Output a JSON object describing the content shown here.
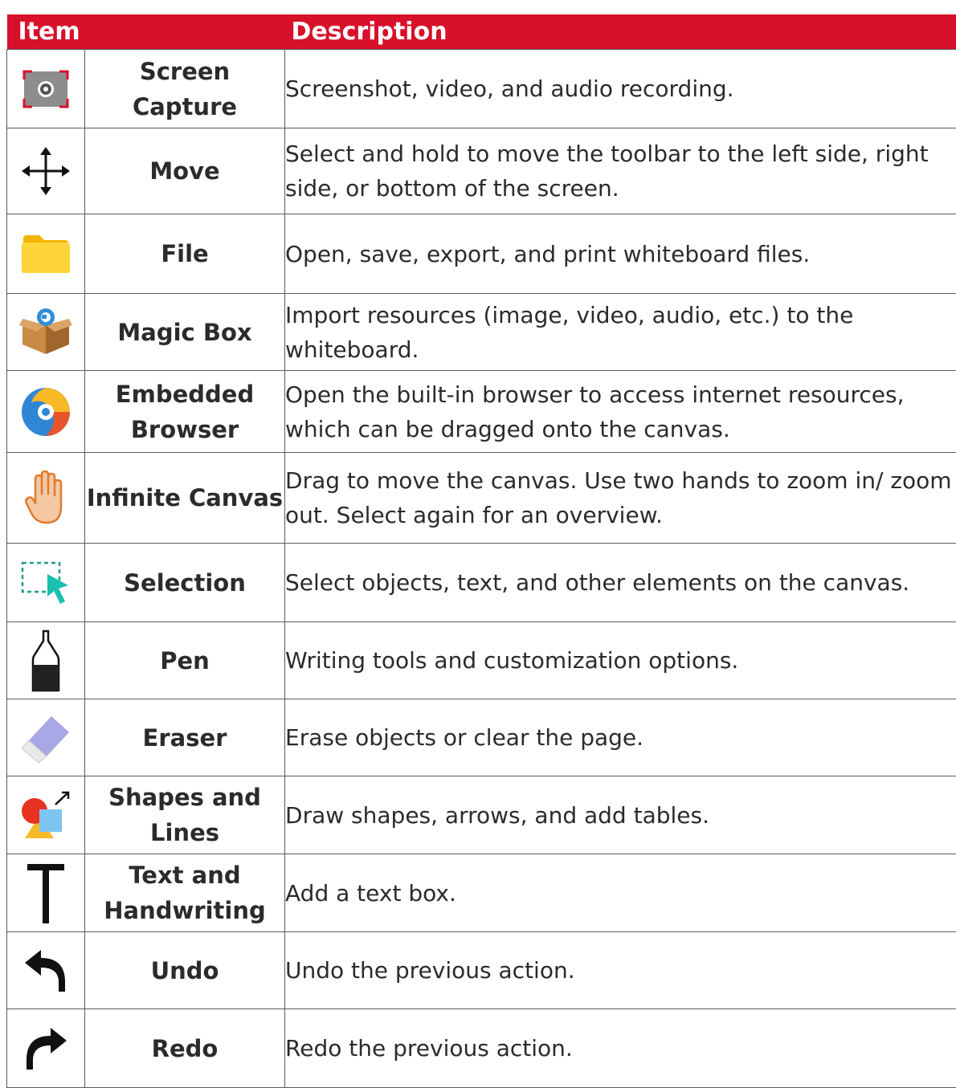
{
  "header": {
    "item": "Item",
    "description": "Description"
  },
  "rows": [
    {
      "icon": "screen-capture-icon",
      "name": "Screen Capture",
      "description": "Screenshot, video, and audio recording."
    },
    {
      "icon": "move-arrows-icon",
      "name": "Move",
      "description": "Select and hold to move the toolbar to the left side, right side, or bottom of the screen."
    },
    {
      "icon": "folder-icon",
      "name": "File",
      "description": "Open, save, export, and print whiteboard files."
    },
    {
      "icon": "magic-box-icon",
      "name": "Magic Box",
      "description": "Import resources (image, video, audio, etc.) to the whiteboard."
    },
    {
      "icon": "browser-icon",
      "name": "Embedded Browser",
      "description": "Open the built-in browser to access internet resources, which can be dragged onto the canvas."
    },
    {
      "icon": "hand-icon",
      "name": "Infinite Canvas",
      "description": "Drag to move the canvas. Use two hands to zoom in/ zoom out. Select again for an overview."
    },
    {
      "icon": "selection-icon",
      "name": "Selection",
      "description": "Select objects, text, and other elements on the canvas."
    },
    {
      "icon": "pen-icon",
      "name": "Pen",
      "description": "Writing tools and customization options."
    },
    {
      "icon": "eraser-icon",
      "name": "Eraser",
      "description": "Erase objects or clear the page."
    },
    {
      "icon": "shapes-icon",
      "name": "Shapes and Lines",
      "description": "Draw shapes, arrows, and add tables."
    },
    {
      "icon": "text-icon",
      "name": "Text and Handwriting",
      "description": "Add a text box."
    },
    {
      "icon": "undo-icon",
      "name": "Undo",
      "description": "Undo the previous action."
    },
    {
      "icon": "redo-icon",
      "name": "Redo",
      "description": "Redo the previous action."
    }
  ],
  "colors": {
    "header_bg": "#d8102a",
    "header_text": "#ffffff",
    "border": "#5a5a5a"
  }
}
